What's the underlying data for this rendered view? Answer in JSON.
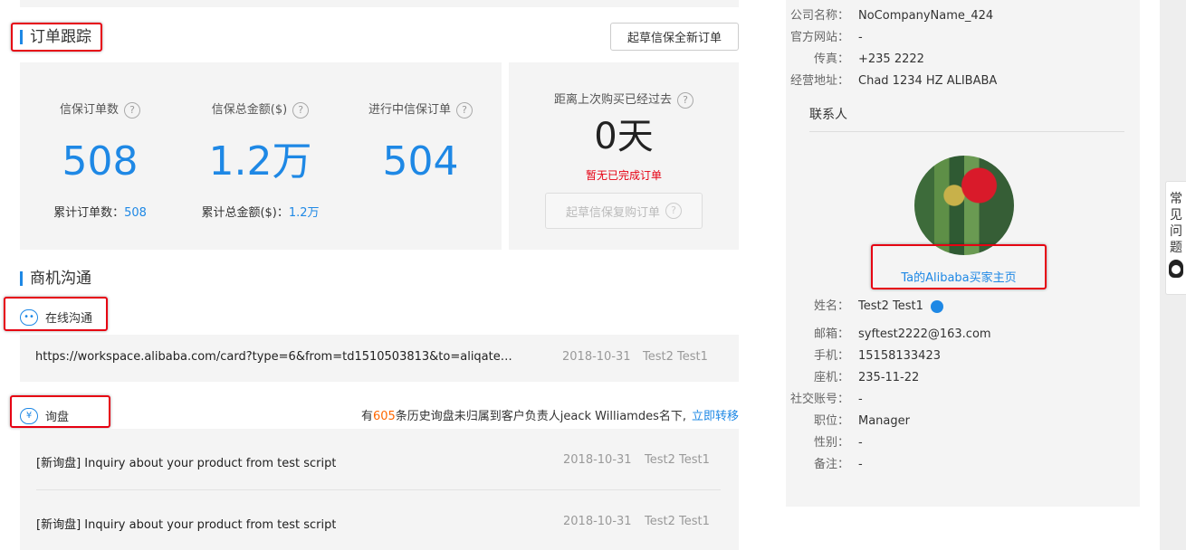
{
  "order_tracking": {
    "title": "订单跟踪",
    "new_order_button": "起草信保全新订单",
    "help_mark": "?",
    "stats": [
      {
        "label": "信保订单数",
        "value": "508",
        "sub_label": "累计订单数：",
        "sub_value": "508"
      },
      {
        "label": "信保总金额($)",
        "value": "1.2万",
        "sub_label": "累计总金额($)：",
        "sub_value": "1.2万"
      },
      {
        "label": "进行中信保订单",
        "value": "504"
      }
    ],
    "last_purchase": {
      "label": "距离上次购买已经过去",
      "value": "0天",
      "warning": "暂无已完成订单",
      "repurchase_button": "起草信保复购订单"
    }
  },
  "communication": {
    "title": "商机沟通",
    "online": {
      "title": "在线沟通",
      "icon": "chat-bubble-icon",
      "items": [
        {
          "text": "https://workspace.alibaba.com/card?type=6&from=td1510503813&to=aliqate…",
          "date": "2018-10-31",
          "user": "Test2 Test1"
        }
      ]
    },
    "inquiry": {
      "title": "询盘",
      "icon": "yen-chat-icon",
      "note_prefix": "有",
      "note_count": "605",
      "note_suffix": "条历史询盘未归属到客户负责人jeack Williamdes名下,",
      "note_link": "立即转移",
      "items": [
        {
          "text": "[新询盘] Inquiry about your product from test script",
          "date": "2018-10-31",
          "user": "Test2 Test1"
        },
        {
          "text": "[新询盘] Inquiry about your product from test script",
          "date": "2018-10-31",
          "user": "Test2 Test1"
        }
      ]
    }
  },
  "company": {
    "fields": [
      {
        "key": "公司名称：",
        "value": "NoCompanyName_424"
      },
      {
        "key": "官方网站：",
        "value": "-"
      },
      {
        "key": "传真：",
        "value": "+235 2222"
      },
      {
        "key": "经营地址：",
        "value": "Chad  1234  HZ  ALIBABA"
      }
    ]
  },
  "contact": {
    "title": "联系人",
    "buyer_link": "Ta的Alibaba买家主页",
    "fields": [
      {
        "key": "姓名：",
        "value": "Test2 Test1"
      },
      {
        "key": "邮箱：",
        "value": "syftest2222@163.com"
      },
      {
        "key": "手机：",
        "value": "15158133423"
      },
      {
        "key": "座机：",
        "value": "235-11-22"
      },
      {
        "key": "社交账号：",
        "value": "-"
      },
      {
        "key": "职位：",
        "value": "Manager"
      },
      {
        "key": "性别：",
        "value": "-"
      },
      {
        "key": "备注：",
        "value": "-"
      }
    ]
  },
  "faq_tab": {
    "chars": [
      "常",
      "见",
      "问",
      "题"
    ]
  },
  "colors": {
    "accent": "#1e88e5",
    "warning": "#e60012",
    "count": "#ff6600",
    "highlight_box": "#e60012"
  }
}
